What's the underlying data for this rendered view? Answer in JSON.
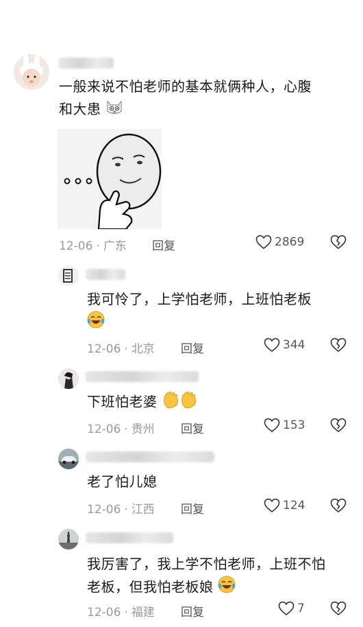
{
  "comments": [
    {
      "text": "一般来说不怕老师的基本就俩种人，心腹和大患",
      "line1": "一般来说不怕老师的基本就俩种人，心腹",
      "line2": "和大患",
      "date": "12-06",
      "location": "广东",
      "reply_label": "回复",
      "likes": "2869",
      "avatar_icon": "baby-bunny-avatar",
      "emoji_icon": "cat-face-icon",
      "sticker": "smiling-face-thinking-sticker"
    },
    {
      "text": "我可怜了，上学怕老师，上班怕老板",
      "date": "12-06",
      "location": "北京",
      "reply_label": "回复",
      "likes": "344",
      "emoji_icon": "crying-laughing-icon"
    },
    {
      "text": "下班怕老婆",
      "date": "12-06",
      "location": "贵州",
      "reply_label": "回复",
      "likes": "153",
      "emoji_icon": "clapping-hands-icon"
    },
    {
      "text": "老了怕儿媳",
      "date": "12-06",
      "location": "江西",
      "reply_label": "回复",
      "likes": "124"
    },
    {
      "text": "我厉害了，我上学不怕老师，上班不怕老板，但我怕老板娘",
      "line1": "我厉害了，我上学不怕老师，上班不怕",
      "line2": "老板，但我怕老板娘",
      "date": "12-06",
      "location": "福建",
      "reply_label": "回复",
      "likes": "7",
      "emoji_icon": "crying-laughing-icon"
    }
  ],
  "colors": {
    "text": "#1a1a1a",
    "meta": "#9a9a9a",
    "laugh_emoji": "#f4c542"
  }
}
